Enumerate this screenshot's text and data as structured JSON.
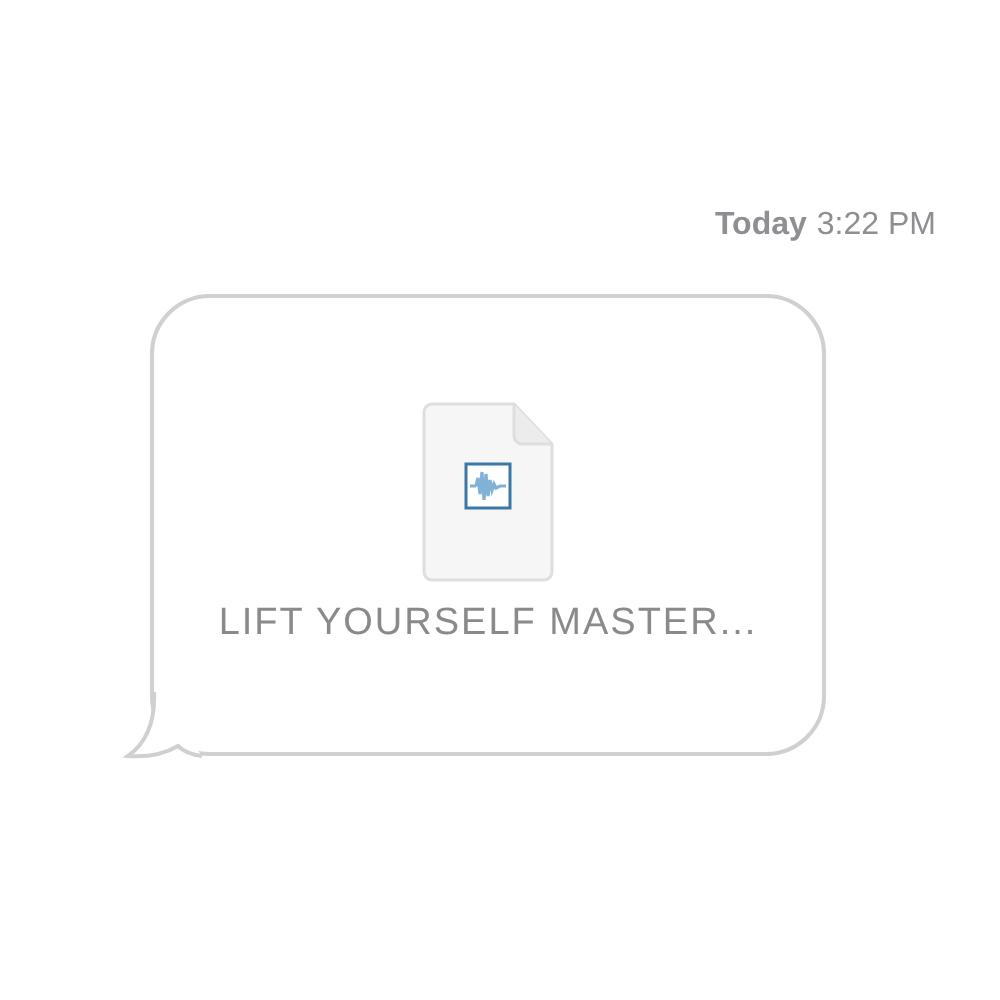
{
  "timestamp": {
    "day": "Today",
    "time": "3:22 PM"
  },
  "message": {
    "attachment": {
      "kind": "audio",
      "filename": "LIFT YOURSELF MASTER..."
    }
  }
}
